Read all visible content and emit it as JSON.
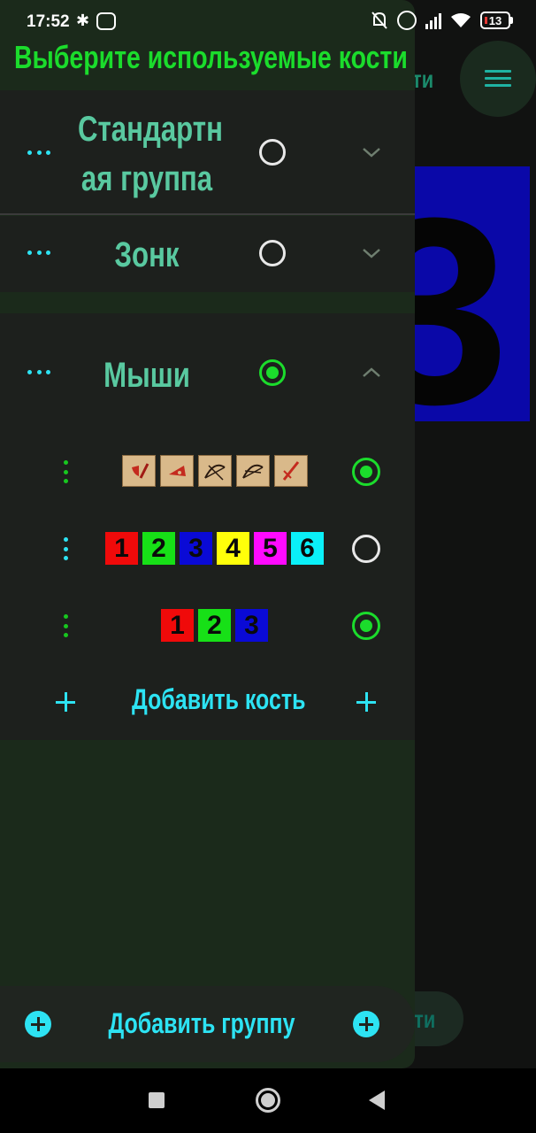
{
  "status_bar": {
    "time": "17:52",
    "battery_level": "13"
  },
  "background": {
    "title_fragment": "ти",
    "bottom_button_fragment": "сти"
  },
  "drawer": {
    "title": "Выберите используемые кости",
    "groups": [
      {
        "name": "Стандартн\nая группа",
        "selected": false,
        "expanded": false
      },
      {
        "name": "Зонк",
        "selected": false,
        "expanded": false
      },
      {
        "name": "Мыши",
        "selected": true,
        "expanded": true
      }
    ],
    "mice_dice": [
      {
        "type": "icons",
        "icons": [
          "sword-shield-icon",
          "cheese-icon",
          "bow-icon",
          "bow-icon",
          "sword-icon"
        ],
        "selected": true
      },
      {
        "type": "numbers",
        "faces": [
          "1",
          "2",
          "3",
          "4",
          "5",
          "6"
        ],
        "selected": false
      },
      {
        "type": "numbers",
        "faces": [
          "1",
          "2",
          "3"
        ],
        "selected": true
      }
    ],
    "add_die_label": "Добавить кость",
    "add_group_label": "Добавить группу"
  },
  "colors": {
    "title_green": "#1bdc2c",
    "group_name": "#59c9a0",
    "accent_cyan": "#2de3f3",
    "face_1": "#f00a0a",
    "face_2": "#17e017",
    "face_3": "#0a0ad6",
    "face_4": "#ffff0a",
    "face_5": "#ff0aff",
    "face_6": "#0af0f8"
  }
}
